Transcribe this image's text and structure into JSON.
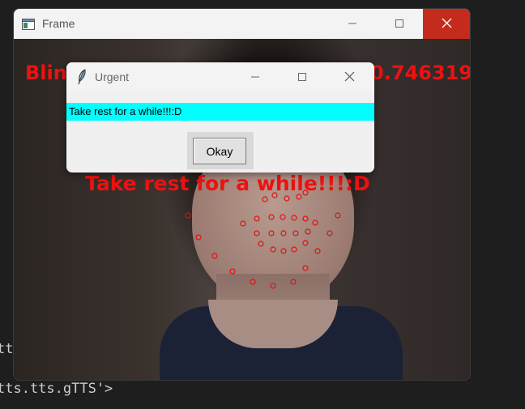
{
  "terminal": {
    "line1": "tt",
    "line2": "tts.tts.gTTS'>"
  },
  "frame": {
    "title": "Frame",
    "icons": {
      "app": "tk-window-icon",
      "minimize": "minimize-icon",
      "maximize": "maximize-icon",
      "close": "close-icon"
    },
    "overlay": {
      "blinks": "Blinks:14",
      "ear": "EAR:0.746319",
      "warning": "Take rest for a while!!!:D",
      "color": "#ee1111"
    }
  },
  "dialog": {
    "title": "Urgent",
    "icon": "feather-icon",
    "message": "Take rest for a while!!!:D",
    "message_bg": "#00ffff",
    "ok_label": "Okay"
  }
}
